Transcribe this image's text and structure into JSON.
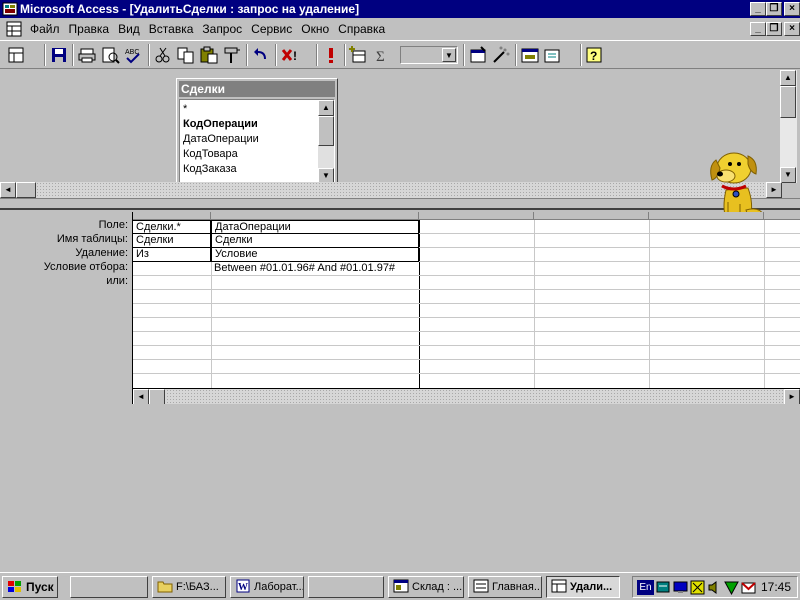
{
  "window": {
    "title": "Microsoft Access - [УдалитьСделки : запрос на удаление]"
  },
  "menu": {
    "items": [
      "Файл",
      "Правка",
      "Вид",
      "Вставка",
      "Запрос",
      "Сервис",
      "Окно",
      "Справка"
    ]
  },
  "toolbar": {
    "icons": [
      "view-icon",
      "save-icon",
      "print-icon",
      "print-preview-icon",
      "spelling-icon",
      "cut-icon",
      "copy-icon",
      "paste-icon",
      "format-painter-icon",
      "undo-icon",
      "query-type-icon",
      "run-icon",
      "show-table-icon",
      "totals-icon",
      "top-values-combo",
      "properties-icon",
      "build-icon",
      "database-window-icon",
      "new-object-icon",
      "help-icon"
    ]
  },
  "table_window": {
    "caption": "Сделки",
    "fields": [
      "*",
      "КодОперации",
      "ДатаОперации",
      "КодТовара",
      "КодЗаказа"
    ]
  },
  "grid": {
    "row_labels": [
      "Поле:",
      "Имя таблицы:",
      "Удаление:",
      "Условие отбора:",
      "или:"
    ],
    "columns": [
      {
        "field": "Сделки.*",
        "table": "Сделки",
        "delete": "Из",
        "criteria": ""
      },
      {
        "field": "ДатаОперации",
        "table": "Сделки",
        "delete": "Условие",
        "criteria": "Between #01.01.96# And #01.01.97#"
      }
    ]
  },
  "taskbar": {
    "start_label": "Пуск",
    "buttons": [
      {
        "label": ""
      },
      {
        "label": "F:\\БАЗ..."
      },
      {
        "label": "Лаборат..."
      },
      {
        "label": ""
      },
      {
        "label": "Склад : ..."
      },
      {
        "label": "Главная..."
      },
      {
        "label": "Удали..."
      }
    ],
    "lang": "En",
    "clock": "17:45"
  }
}
